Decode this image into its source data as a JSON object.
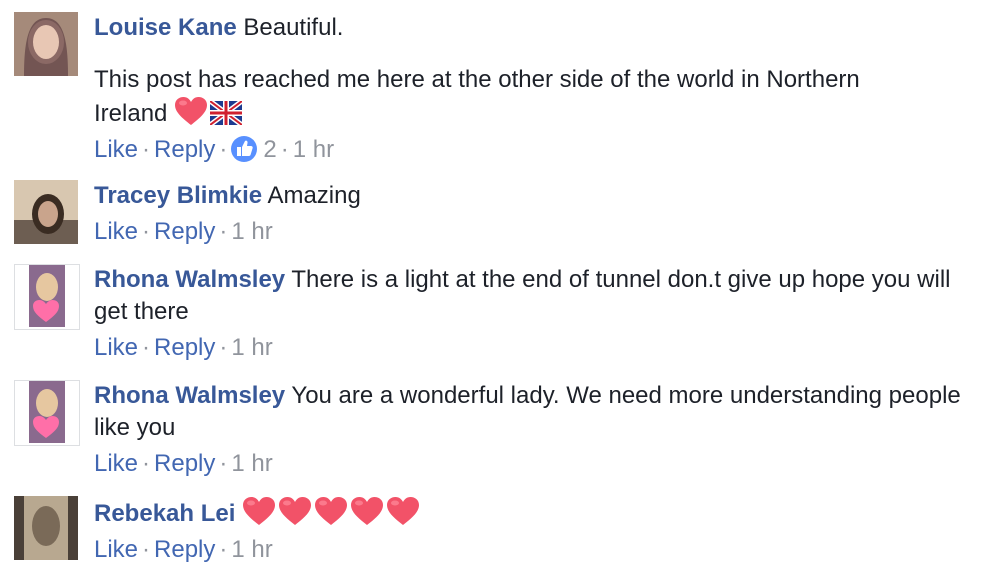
{
  "comments": [
    {
      "author": "Louise Kane",
      "text": "Beautiful.",
      "extra_text": "This post has reached me here at the other side of the world in Northern Ireland",
      "emoji": [
        "red-heart",
        "uk-flag"
      ],
      "actions": {
        "like": "Like",
        "reply": "Reply",
        "reaction_count": "2",
        "time": "1 hr"
      }
    },
    {
      "author": "Tracey Blimkie",
      "text": "Amazing",
      "actions": {
        "like": "Like",
        "reply": "Reply",
        "time": "1 hr"
      }
    },
    {
      "author": "Rhona Walmsley",
      "text": "There is a light at the end of tunnel don.t give up hope you will get there",
      "actions": {
        "like": "Like",
        "reply": "Reply",
        "time": "1 hr"
      }
    },
    {
      "author": "Rhona Walmsley",
      "text": "You are a wonderful lady. We need more understanding people like you",
      "actions": {
        "like": "Like",
        "reply": "Reply",
        "time": "1 hr"
      }
    },
    {
      "author": "Rebekah Lei",
      "text": "",
      "emoji": [
        "red-heart",
        "red-heart",
        "red-heart",
        "red-heart",
        "red-heart"
      ],
      "actions": {
        "like": "Like",
        "reply": "Reply",
        "time": "1 hr"
      }
    }
  ],
  "separator": "·",
  "colors": {
    "author": "#385898",
    "action": "#4267b2",
    "meta": "#90949c",
    "heart": "#f25268",
    "like_badge": "#5890ff"
  }
}
